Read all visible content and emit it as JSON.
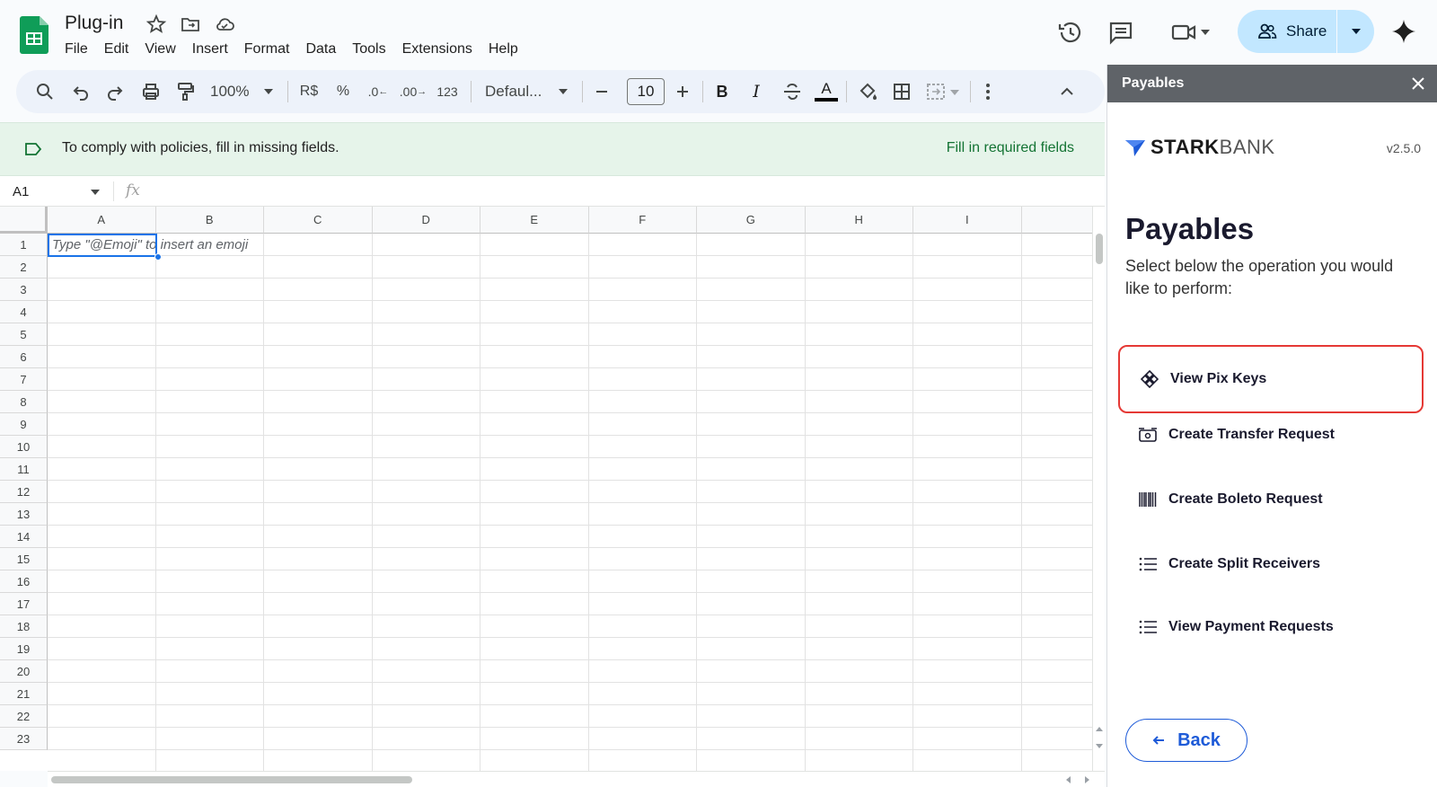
{
  "app": {
    "doc_title": "Plug-in",
    "menu": [
      "File",
      "Edit",
      "View",
      "Insert",
      "Format",
      "Data",
      "Tools",
      "Extensions",
      "Help"
    ],
    "share_label": "Share"
  },
  "toolbar": {
    "zoom": "100%",
    "currency": "R$",
    "percent": "%",
    "dec_decrease": ".0",
    "dec_increase": ".00",
    "format_num": "123",
    "font": "Defaul...",
    "font_size": "10",
    "bold": "B",
    "italic": "I",
    "text_color_letter": "A"
  },
  "banner": {
    "message": "To comply with policies, fill in missing fields.",
    "action": "Fill in required fields"
  },
  "formula_bar": {
    "cell_ref": "A1",
    "fx": "fx"
  },
  "sheet": {
    "columns": [
      "A",
      "B",
      "C",
      "D",
      "E",
      "F",
      "G",
      "H",
      "I"
    ],
    "rows": [
      "1",
      "2",
      "3",
      "4",
      "5",
      "6",
      "7",
      "8",
      "9",
      "10",
      "11",
      "12",
      "13",
      "14",
      "15",
      "16",
      "17",
      "18",
      "19",
      "20",
      "21",
      "22",
      "23"
    ],
    "cell_hint": "Type \"@Emoji\" to insert an emoji"
  },
  "panel": {
    "header": "Payables",
    "brand_bold": "STARK",
    "brand_light": "BANK",
    "version": "v2.5.0",
    "heading": "Payables",
    "subtitle": "Select below the operation you would like to perform:",
    "operations": [
      {
        "label": "View Pix Keys",
        "icon": "pix-icon",
        "highlighted": true
      },
      {
        "label": "Create Transfer Request",
        "icon": "transfer-icon"
      },
      {
        "label": "Create Boleto Request",
        "icon": "barcode-icon"
      },
      {
        "label": "Create Split Receivers",
        "icon": "list-icon"
      },
      {
        "label": "View Payment Requests",
        "icon": "list-icon"
      }
    ],
    "back_label": "Back"
  },
  "colors": {
    "accent_blue": "#1e5bd8",
    "highlight_red": "#e53935",
    "banner_bg": "#e6f4ea",
    "banner_link": "#137333",
    "share_bg": "#c2e7ff",
    "sheets_green": "#0f9d58"
  }
}
